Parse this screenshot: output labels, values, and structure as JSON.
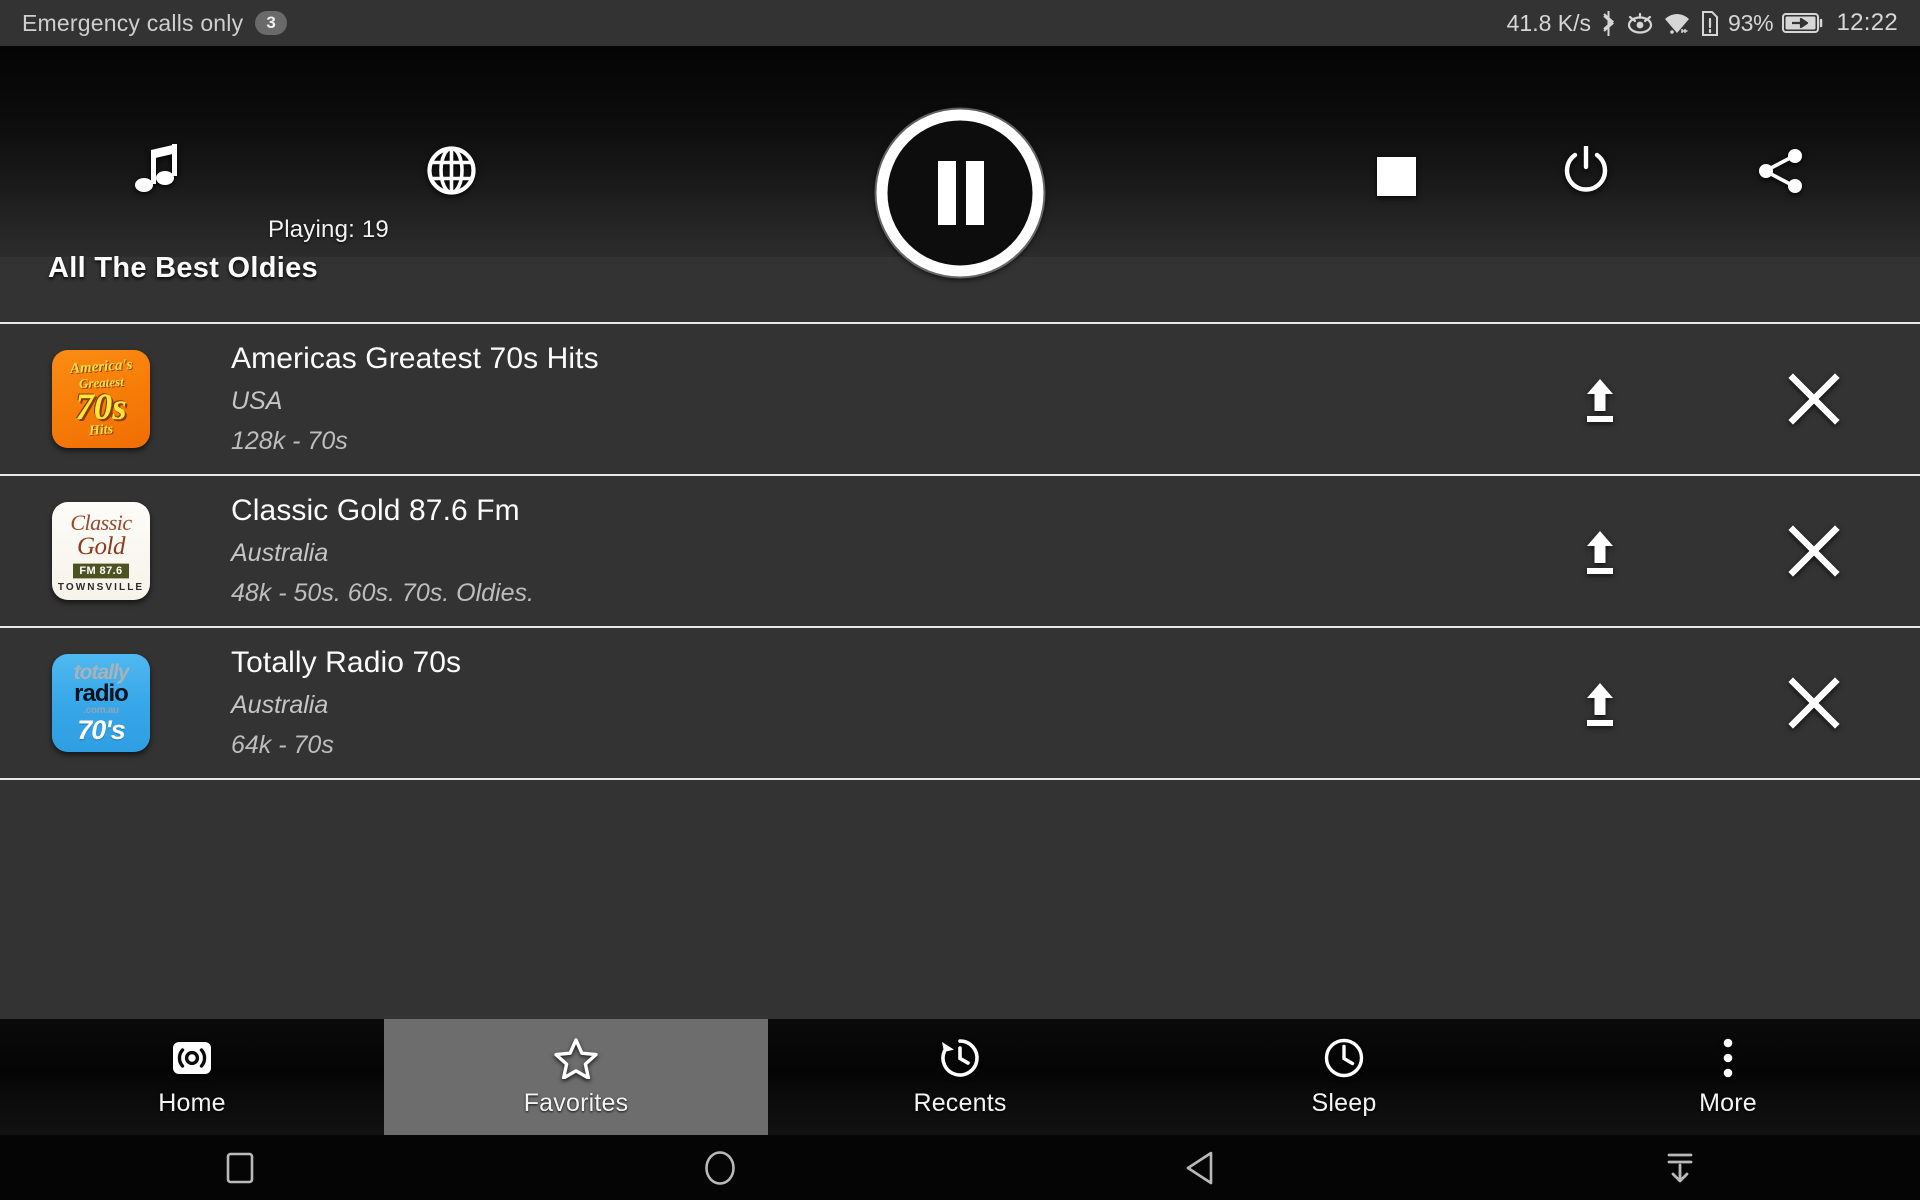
{
  "status_bar": {
    "carrier": "Emergency calls only",
    "notification_count": "3",
    "network_speed": "41.8 K/s",
    "battery_percent": "93%",
    "clock": "12:22",
    "icons": [
      "bluetooth-icon",
      "eye-icon",
      "wifi-icon",
      "sim-alert-icon",
      "battery-charging-icon"
    ]
  },
  "player": {
    "music_icon": "music-note-icon",
    "globe_icon": "globe-icon",
    "play_pause_icon": "pause-icon",
    "stop_icon": "stop-icon",
    "power_icon": "power-icon",
    "share_icon": "share-icon",
    "playing_label": "Playing: 19"
  },
  "section": {
    "title": "All The Best Oldies"
  },
  "stations": [
    {
      "name": "Americas Greatest 70s Hits",
      "country": "USA",
      "meta": "128k - 70s",
      "logo": "americas-greatest-70s-hits-logo",
      "logo_lines": {
        "l1": "America's",
        "l2": "Greatest",
        "l3": "70s",
        "l4": "Hits"
      },
      "move_icon": "move-to-top-icon",
      "remove_icon": "remove-icon"
    },
    {
      "name": "Classic Gold 87.6 Fm",
      "country": "Australia",
      "meta": "48k - 50s. 60s. 70s. Oldies.",
      "logo": "classic-gold-logo",
      "logo_lines": {
        "g1": "Classic",
        "g2": "Gold",
        "g3": "FM 87.6",
        "g4": "TOWNSVILLE"
      },
      "move_icon": "move-to-top-icon",
      "remove_icon": "remove-icon"
    },
    {
      "name": "Totally Radio 70s",
      "country": "Australia",
      "meta": "64k - 70s",
      "logo": "totally-radio-70s-logo",
      "logo_lines": {
        "t1": "totally",
        "t2": "radio",
        "t3": ".com.au",
        "t4": "70's"
      },
      "move_icon": "move-to-top-icon",
      "remove_icon": "remove-icon"
    }
  ],
  "tabs": [
    {
      "label": "Home",
      "icon": "radio-broadcast-icon",
      "selected": false
    },
    {
      "label": "Favorites",
      "icon": "star-icon",
      "selected": true
    },
    {
      "label": "Recents",
      "icon": "history-icon",
      "selected": false
    },
    {
      "label": "Sleep",
      "icon": "clock-icon",
      "selected": false
    },
    {
      "label": "More",
      "icon": "more-vertical-icon",
      "selected": false
    }
  ],
  "android_nav": [
    {
      "icon": "recents-square-icon"
    },
    {
      "icon": "home-circle-icon"
    },
    {
      "icon": "back-triangle-icon"
    },
    {
      "icon": "hide-navbar-icon"
    }
  ],
  "colors": {
    "page_background": "#333333",
    "header_gradient_top": "#040404",
    "header_gradient_bottom": "#2c2c2c",
    "status_bar_background": "#333333",
    "divider": "#e8e8e8",
    "tab_selected_background": "#6d6d6d",
    "tabbar_background": "#0a0a0a",
    "android_nav_background": "#050505",
    "primary_text": "#fcfcfc",
    "secondary_text": "#c5c5c5"
  }
}
